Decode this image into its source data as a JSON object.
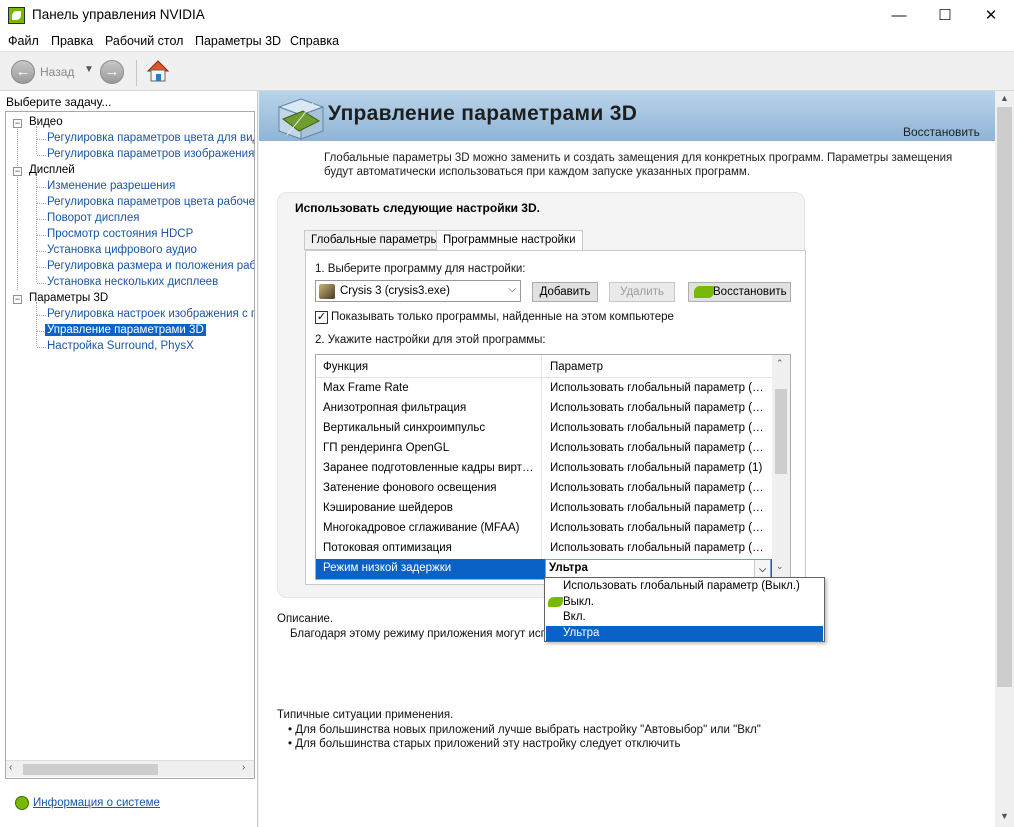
{
  "window": {
    "title": "Панель управления NVIDIA",
    "minimize": "—",
    "maximize": "☐",
    "close": "✕"
  },
  "menu": {
    "file": "Файл",
    "edit": "Правка",
    "desktop": "Рабочий стол",
    "params3d": "Параметры 3D",
    "help": "Справка"
  },
  "toolbar": {
    "back_label": "Назад",
    "back_icon": "arrow-left-icon",
    "forward_icon": "arrow-right-icon",
    "home_icon": "home-icon"
  },
  "sidebar": {
    "header": "Выберите задачу...",
    "categories": [
      {
        "label": "Видео",
        "items": [
          "Регулировка параметров цвета для вид",
          "Регулировка параметров изображения д"
        ]
      },
      {
        "label": "Дисплей",
        "items": [
          "Изменение разрешения",
          "Регулировка параметров цвета рабочег",
          "Поворот дисплея",
          "Просмотр состояния HDCP",
          "Установка цифрового аудио",
          "Регулировка размера и положения рабо",
          "Установка нескольких дисплеев"
        ]
      },
      {
        "label": "Параметры 3D",
        "items": [
          "Регулировка настроек изображения с пр",
          "Управление параметрами 3D",
          "Настройка Surround, PhysX"
        ]
      }
    ],
    "selected": "Управление параметрами 3D",
    "sysinfo_link": "Информация о системе"
  },
  "main": {
    "title": "Управление параметрами 3D",
    "restore": "Восстановить",
    "intro": "Глобальные параметры 3D можно заменить и создать замещения для конкретных программ. Параметры замещения будут автоматически использоваться при каждом запуске указанных программ.",
    "box_title": "Использовать следующие настройки 3D.",
    "tabs": [
      "Глобальные параметры",
      "Программные настройки"
    ],
    "active_tab": "Программные настройки",
    "step1": "1. Выберите программу для настройки:",
    "program": "Crysis 3 (crysis3.exe)",
    "add_button": "Добавить",
    "remove_button": "Удалить",
    "restore_button": "Восстановить",
    "checkbox_label": "Показывать только программы, найденные на этом компьютере",
    "checkbox_checked": true,
    "step2": "2. Укажите настройки для этой программы:",
    "grid": {
      "col_function": "Функция",
      "col_param": "Параметр",
      "rows": [
        {
          "fn": "Max Frame Rate",
          "param": "Использовать глобальный параметр (Off)"
        },
        {
          "fn": "Анизотропная фильтрация",
          "param": "Использовать глобальный параметр (Упр"
        },
        {
          "fn": "Вертикальный синхроимпульс",
          "param": "Использовать глобальный параметр (Исп"
        },
        {
          "fn": "ГП рендеринга OpenGL",
          "param": "Использовать глобальный параметр (Авто"
        },
        {
          "fn": "Заранее подготовленные кадры виртуальной",
          "param": "Использовать глобальный параметр (1)"
        },
        {
          "fn": "Затенение фонового освещения",
          "param": "Использовать глобальный параметр (Выкл"
        },
        {
          "fn": "Кэширование шейдеров",
          "param": "Использовать глобальный параметр (Вкл.)"
        },
        {
          "fn": "Многокадровое сглаживание (MFAA)",
          "param": "Использовать глобальный параметр (Выкл"
        },
        {
          "fn": "Потоковая оптимизация",
          "param": "Использовать глобальный параметр (Авто"
        },
        {
          "fn": "Режим низкой задержки",
          "param": "Ультра"
        }
      ],
      "selected_row": "Режим низкой задержки"
    },
    "dropdown": {
      "options": [
        "Использовать глобальный параметр (Выкл.)",
        "Выкл.",
        "Вкл.",
        "Ультра"
      ],
      "highlighted": "Ультра"
    },
    "description_label": "Описание.",
    "description_text": "Благодаря этому режиму приложения могут испол",
    "usage_label": "Типичные ситуации применения.",
    "usage_items": [
      "Для большинства новых приложений лучше выбрать настройку \"Автовыбор\" или \"Вкл\"",
      "Для большинства старых приложений эту настройку следует отключить"
    ]
  },
  "colors": {
    "accent": "#0b62c6",
    "nvidia_green": "#76b900",
    "link": "#1a56a8"
  }
}
